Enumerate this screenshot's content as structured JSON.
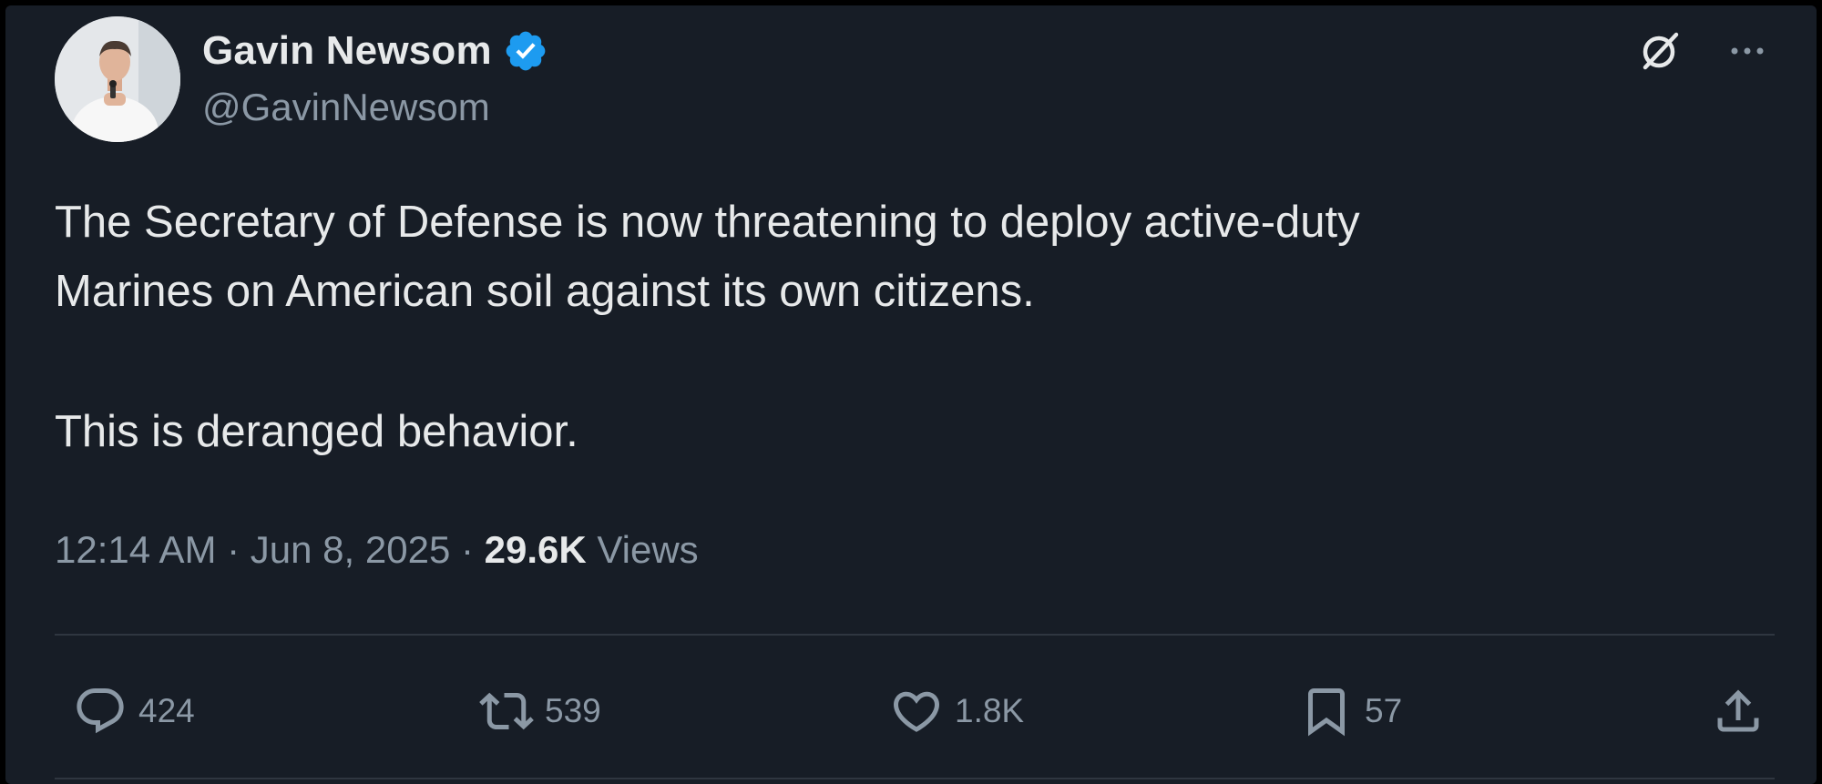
{
  "author": {
    "display_name": "Gavin Newsom",
    "handle": "@GavinNewsom",
    "verified": true,
    "avatar_icon": "person-portrait"
  },
  "header_icons": {
    "grok": "grok-icon",
    "more": "more-icon"
  },
  "tweet": {
    "lines": [
      "The Secretary of Defense is now threatening to deploy active-duty",
      "Marines on American soil against its own citizens.",
      "This is deranged behavior."
    ]
  },
  "meta": {
    "time": "12:14 AM",
    "separator": "·",
    "date": "Jun 8, 2025",
    "views_count": "29.6K",
    "views_label": "Views"
  },
  "actions": {
    "replies": "424",
    "reposts": "539",
    "likes": "1.8K",
    "bookmarks": "57"
  },
  "colors": {
    "background": "#171d26",
    "text_primary": "#e7e9ea",
    "text_secondary": "#8b98a5",
    "verified_badge": "#1d9bf0",
    "divider": "#2f3640"
  }
}
